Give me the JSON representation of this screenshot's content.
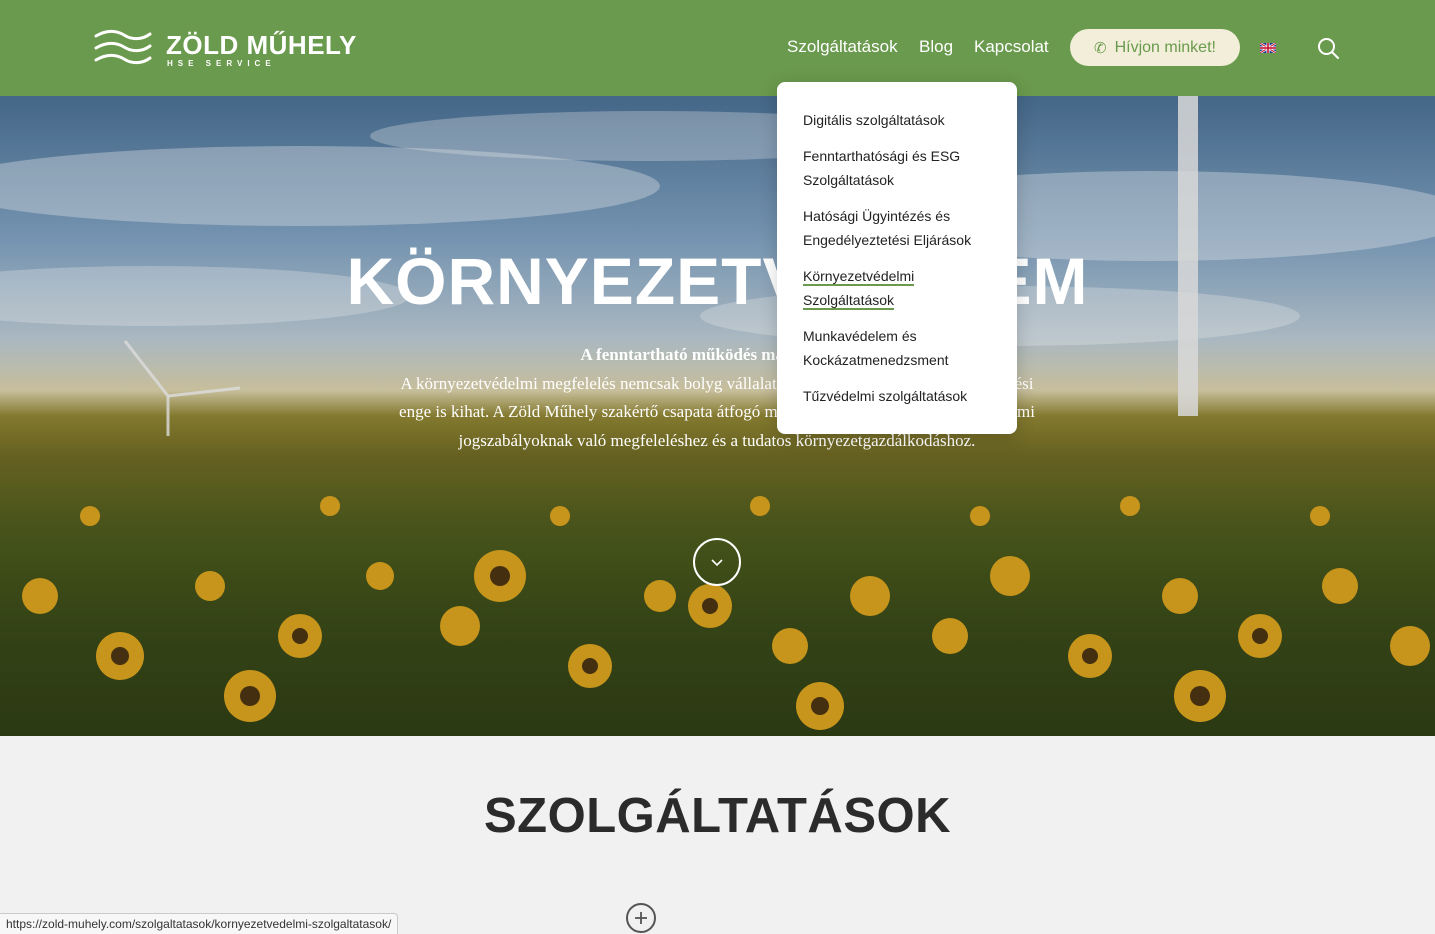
{
  "header": {
    "logo_name": "ZÖLD MŰHELY",
    "logo_tagline": "HSE SERVICE",
    "nav": {
      "services": "Szolgáltatások",
      "blog": "Blog",
      "contact": "Kapcsolat"
    },
    "call_button": "Hívjon minket!",
    "language_icon": "uk-flag-icon",
    "search_icon": "search-icon"
  },
  "dropdown": {
    "items": [
      "Digitális szolgáltatások",
      "Fenntarthatósági és ESG Szolgáltatások",
      "Hatósági Ügyintézés és Engedélyeztetési Eljárások",
      "Környezetvédelmi Szolgáltatások",
      "Munkavédelem és Kockázatmenedzsment",
      "Tűzvédelmi szolgáltatások"
    ],
    "active_index": 3
  },
  "hero": {
    "title": "KÖRNYEZETVÉDELEM",
    "lead": "A fenntartható működés ma már nem",
    "body": "A környezetvédelmi megfelelés nemcsak bolyg vállalatok társadalmi megítélésére, működési enge is kihat. A Zöld Műhely szakértő csapata átfogó megoldásokat kínál a környezetvédelmi jogszabályoknak való megfeleléshez és a tudatos környezetgazdálkodáshoz."
  },
  "section": {
    "title": "SZOLGÁLTATÁSOK"
  },
  "status_bar": {
    "url": "https://zold-muhely.com/szolgaltatasok/kornyezetvedelmi-szolgaltatasok/"
  },
  "colors": {
    "brand_green": "#6a9a4d",
    "call_button_bg": "#f2eed9"
  }
}
